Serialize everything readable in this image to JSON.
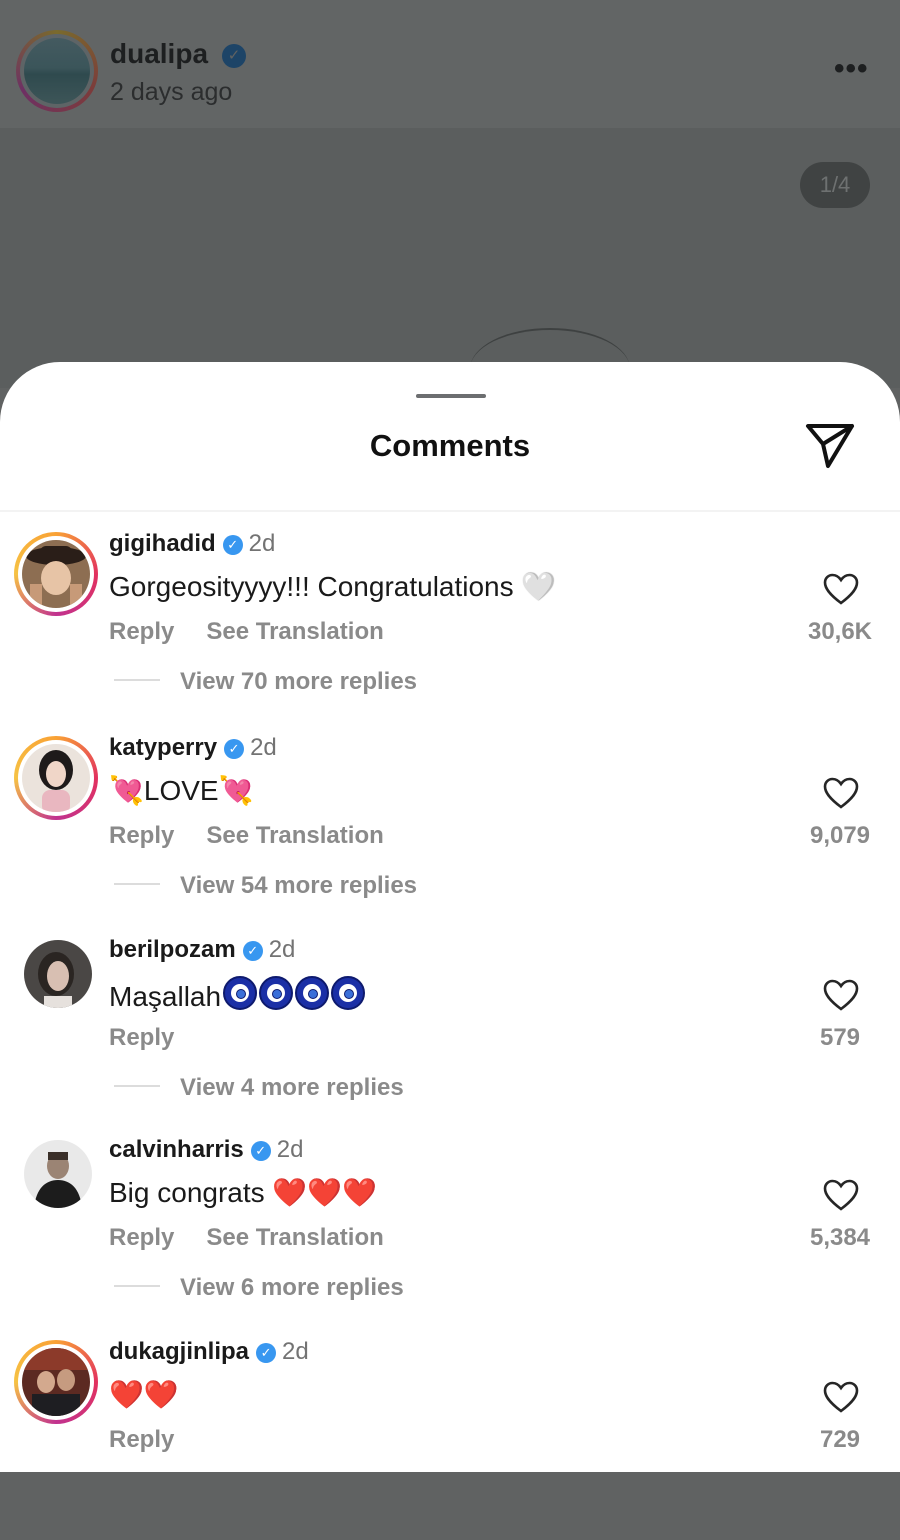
{
  "post": {
    "username": "dualipa",
    "time": "2 days ago",
    "more_icon": "ellipsis-icon",
    "page_counter": "1/4"
  },
  "sheet": {
    "title": "Comments",
    "share_icon": "paper-plane-icon"
  },
  "colors": {
    "verified": "#3897f0",
    "story_ring": "#e2315f",
    "muted_text": "#8a8a8a"
  },
  "comments": [
    {
      "username": "gigihadid",
      "time": "2d",
      "text": "Gorgeosityyyy!!! Congratulations",
      "emoji": "🤍",
      "reply": "Reply",
      "translate": "See Translation",
      "replies": "View 70 more replies",
      "likes": "30,6K"
    },
    {
      "username": "katyperry",
      "time": "2d",
      "text": "LOVE",
      "emoji": "💘",
      "reply": "Reply",
      "translate": "See Translation",
      "replies": "View 54 more replies",
      "likes": "9,079"
    },
    {
      "username": "berilpozam",
      "time": "2d",
      "text": "Maşallah",
      "emoji": "🧿🧿🧿🧿",
      "reply": "Reply",
      "replies": "View 4 more replies",
      "likes": "579"
    },
    {
      "username": "calvinharris",
      "time": "2d",
      "text": "Big congrats",
      "emoji": "❤️❤️❤️",
      "reply": "Reply",
      "translate": "See Translation",
      "replies": "View 6 more replies",
      "likes": "5,384"
    },
    {
      "username": "dukagjinlipa",
      "time": "2d",
      "text": "",
      "emoji": "❤️❤️",
      "reply": "Reply",
      "likes": "729"
    }
  ]
}
